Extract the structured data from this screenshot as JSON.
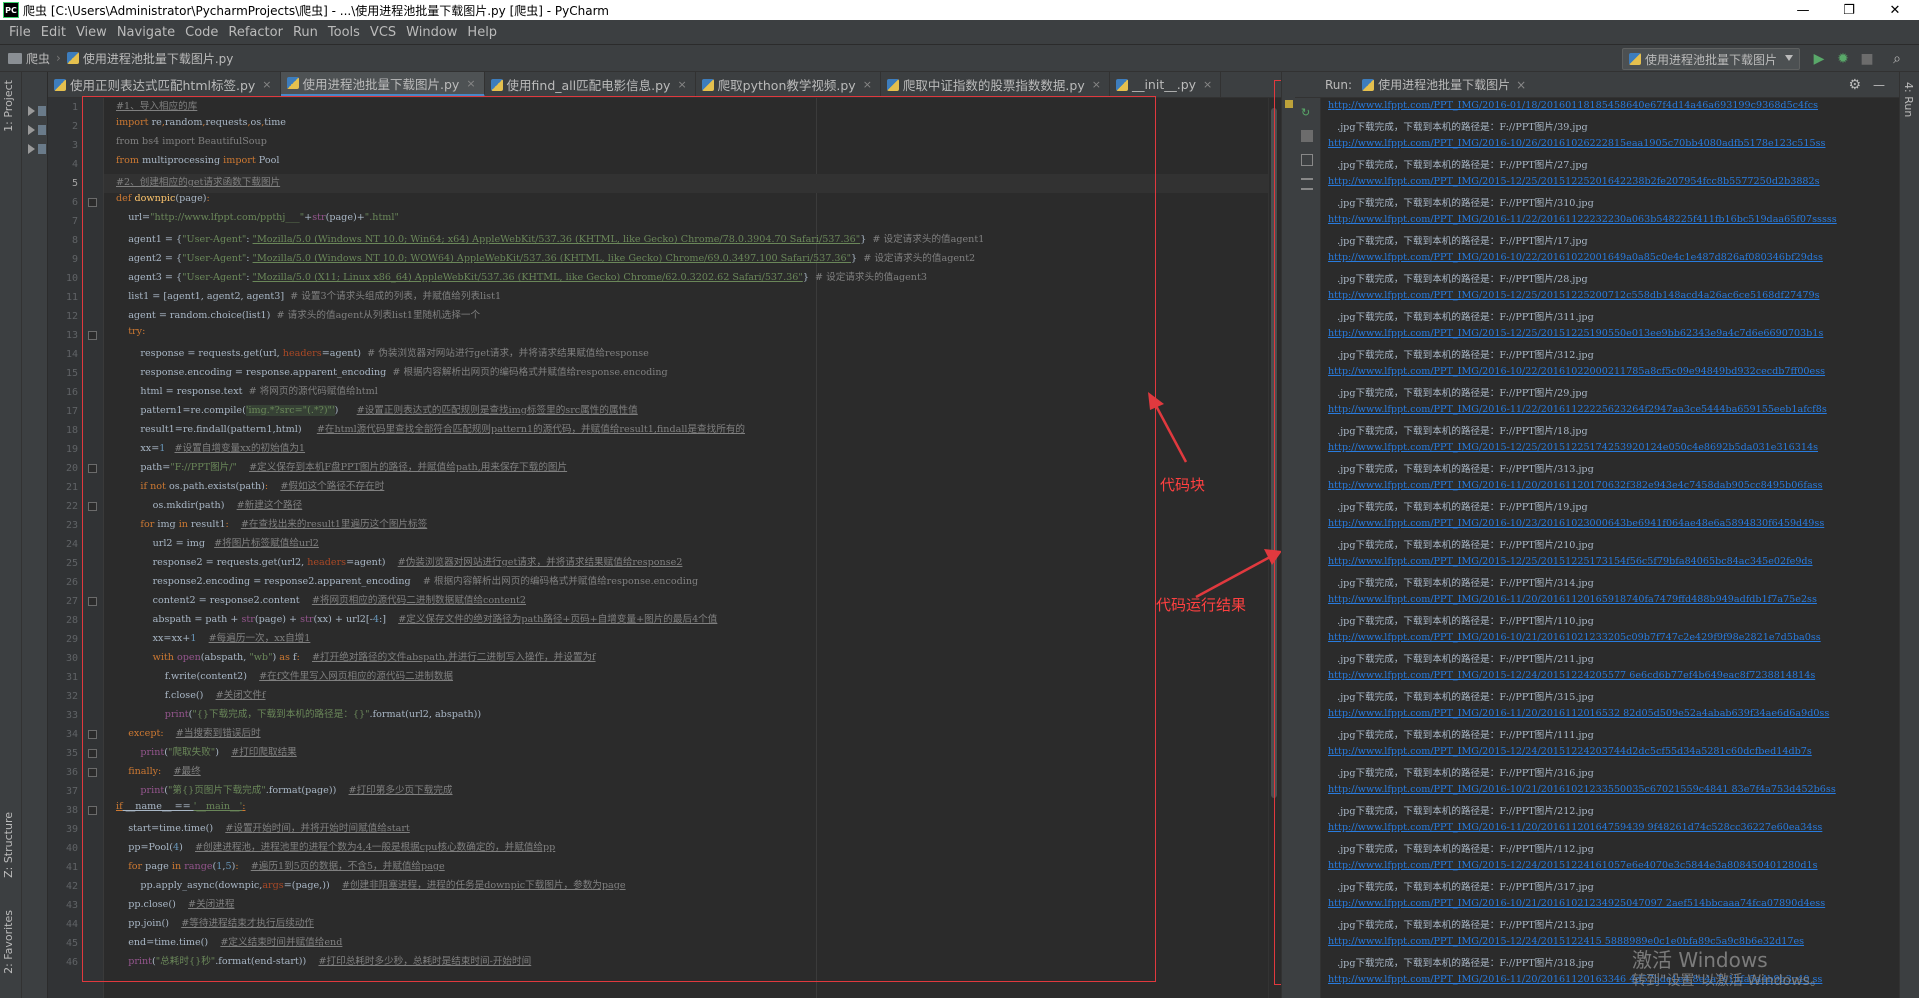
{
  "window": {
    "title": "爬虫 [C:\\Users\\Administrator\\PycharmProjects\\爬虫] - ...\\使用进程池批量下载图片.py [爬虫] - PyCharm",
    "logo_text": "PC",
    "min": "—",
    "max": "❐",
    "close": "✕"
  },
  "menu": [
    "File",
    "Edit",
    "View",
    "Navigate",
    "Code",
    "Refactor",
    "Run",
    "Tools",
    "VCS",
    "Window",
    "Help"
  ],
  "navbar": {
    "project": "爬虫",
    "file": "使用进程池批量下载图片.py"
  },
  "run_config": {
    "label": "使用进程池批量下载图片"
  },
  "left_tools": {
    "project": "1: Project",
    "structure": "Z: Structure",
    "favorites": "2: Favorites"
  },
  "tabs": [
    {
      "label": "使用正则表达式匹配html标签.py",
      "active": false
    },
    {
      "label": "使用进程池批量下载图片.py",
      "active": true
    },
    {
      "label": "使用find_all匹配电影信息.py",
      "active": false
    },
    {
      "label": "爬取python教学视频.py",
      "active": false
    },
    {
      "label": "爬取中证指数的股票指数数据.py",
      "active": false
    },
    {
      "label": "__init__.py",
      "active": false
    }
  ],
  "tab_close": "×",
  "code": {
    "line_numbers": [
      "1",
      "2",
      "3",
      "4",
      "5",
      "6",
      "7",
      "8",
      "9",
      "10",
      "11",
      "12",
      "13",
      "14",
      "15",
      "16",
      "17",
      "18",
      "19",
      "20",
      "21",
      "22",
      "23",
      "24",
      "25",
      "26",
      "27",
      "28",
      "29",
      "30",
      "31",
      "32",
      "33",
      "34",
      "35",
      "36",
      "37",
      "38",
      "39",
      "40",
      "41",
      "42",
      "43",
      "44",
      "45",
      "46"
    ],
    "current_line": 5
  },
  "annotations": {
    "code_block": "代码块",
    "run_result": "代码运行结果"
  },
  "run_panel": {
    "label": "Run:",
    "config": "使用进程池批量下载图片",
    "gear": "⚙",
    "hide": "—",
    "side_label": "4: Run"
  },
  "output": [
    {
      "link": "http://www.lfppt.com/PPT_IMG/2016-01/18/20160118185458640e67f4d14a46a693199c9368d5c4fcs"
    },
    {
      "text": "   .jpg下载完成，下载到本机的路径是：F://PPT图片/39.jpg"
    },
    {
      "link": "http://www.lfppt.com/PPT_IMG/2016-10/26/20161026222815eaa1905c70bb4080adfb5178e123c515ss"
    },
    {
      "text": "   .jpg下载完成，下载到本机的路径是：F://PPT图片/27.jpg"
    },
    {
      "link": "http://www.lfppt.com/PPT_IMG/2015-12/25/20151225201642238b2fe207954fcc8b5577250d2b3882s"
    },
    {
      "text": "   .jpg下载完成，下载到本机的路径是：F://PPT图片/310.jpg"
    },
    {
      "link": "http://www.lfppt.com/PPT_IMG/2016-11/22/20161122232230a063b548225f411fb16bc519daa65f07sssss"
    },
    {
      "text": "   .jpg下载完成，下载到本机的路径是：F://PPT图片/17.jpg"
    },
    {
      "link": "http://www.lfppt.com/PPT_IMG/2016-10/22/20161022001649a0a85c0e4c1e487d826af080346bf29dss"
    },
    {
      "text": "   .jpg下载完成，下载到本机的路径是：F://PPT图片/28.jpg"
    },
    {
      "link": "http://www.lfppt.com/PPT_IMG/2015-12/25/20151225200712c558db148acd4a26ac6ce5168df27479s"
    },
    {
      "text": "   .jpg下载完成，下载到本机的路径是：F://PPT图片/311.jpg"
    },
    {
      "link": "http://www.lfppt.com/PPT_IMG/2015-12/25/20151225190550e013ee9bb62343e9a4c7d6e6690703b1s"
    },
    {
      "text": "   .jpg下载完成，下载到本机的路径是：F://PPT图片/312.jpg"
    },
    {
      "link": "http://www.lfppt.com/PPT_IMG/2016-10/22/20161022000211785a8cf5c09e94849bd932cecdb7ff00ess"
    },
    {
      "text": "   .jpg下载完成，下载到本机的路径是：F://PPT图片/29.jpg"
    },
    {
      "link": "http://www.lfppt.com/PPT_IMG/2016-11/22/20161122225623264f2947aa3ce5444ba659155eeb1afcf8s"
    },
    {
      "text": "   .jpg下载完成，下载到本机的路径是：F://PPT图片/18.jpg"
    },
    {
      "link": "http://www.lfppt.com/PPT_IMG/2015-12/25/20151225174253920124e050c4e8692b5da031e316314s"
    },
    {
      "text": "   .jpg下载完成，下载到本机的路径是：F://PPT图片/313.jpg"
    },
    {
      "link": "http://www.lfppt.com/PPT_IMG/2016-11/20/20161120170632f382e943e4c7458dab905cc8495b06fass"
    },
    {
      "text": "   .jpg下载完成，下载到本机的路径是：F://PPT图片/19.jpg"
    },
    {
      "link": "http://www.lfppt.com/PPT_IMG/2016-10/23/20161023000643be6941f064ae48e6a5894830f6459d49ss"
    },
    {
      "text": "   .jpg下载完成，下载到本机的路径是：F://PPT图片/210.jpg"
    },
    {
      "link": "http://www.lfppt.com/PPT_IMG/2015-12/25/20151225173154f56c5f79bfa84065bc84ac345e02fe9ds"
    },
    {
      "text": "   .jpg下载完成，下载到本机的路径是：F://PPT图片/314.jpg"
    },
    {
      "link": "http://www.lfppt.com/PPT_IMG/2016-11/20/20161120165918740fa7479ffd488b949adfdb1f7a75e2ss"
    },
    {
      "text": "   .jpg下载完成，下载到本机的路径是：F://PPT图片/110.jpg"
    },
    {
      "link": "http://www.lfppt.com/PPT_IMG/2016-10/21/20161021233205c09b7f747c2e429f9f98e2821e7d5ba0ss"
    },
    {
      "text": "   .jpg下载完成，下载到本机的路径是：F://PPT图片/211.jpg"
    },
    {
      "link": "http://www.lfppt.com/PPT_IMG/2015-12/24/20151224205577 6e6cd6b77ef4b649eac8f7238814814s"
    },
    {
      "text": "   .jpg下载完成，下载到本机的路径是：F://PPT图片/315.jpg"
    },
    {
      "link": "http://www.lfppt.com/PPT_IMG/2016-11/20/2016112016532 82d05d509e52a4abab639f34ae6d6a9d0ss"
    },
    {
      "text": "   .jpg下载完成，下载到本机的路径是：F://PPT图片/111.jpg"
    },
    {
      "link": "http://www.lfppt.com/PPT_IMG/2015-12/24/20151224203744d2dc5cf55d34a5281c60dcfbed14db7s"
    },
    {
      "text": "   .jpg下载完成，下载到本机的路径是：F://PPT图片/316.jpg"
    },
    {
      "link": "http://www.lfppt.com/PPT_IMG/2016-10/21/20161021233550035c67021559c4841 83e7f4a753d452b6ss"
    },
    {
      "text": "   .jpg下载完成，下载到本机的路径是：F://PPT图片/212.jpg"
    },
    {
      "link": "http://www.lfppt.com/PPT_IMG/2016-11/20/20161120164759439 9f48261d74c528cc36227e60ea34ss"
    },
    {
      "text": "   .jpg下载完成，下载到本机的路径是：F://PPT图片/112.jpg"
    },
    {
      "link": "http://www.lfppt.com/PPT_IMG/2015-12/24/20151224161057e6e4070e3c5844e3a808450401280d1s"
    },
    {
      "text": "   .jpg下载完成，下载到本机的路径是：F://PPT图片/317.jpg"
    },
    {
      "link": "http://www.lfppt.com/PPT_IMG/2016-10/21/20161021234925047097 2aef514bbcaaa74fca07890d4ess"
    },
    {
      "text": "   .jpg下载完成，下载到本机的路径是：F://PPT图片/213.jpg"
    },
    {
      "link": "http://www.lfppt.com/PPT_IMG/2015-12/24/2015122415 5888989e0c1e0bfa89c5a9c8b6e32d17es"
    },
    {
      "text": "   .jpg下载完成，下载到本机的路径是：F://PPT图片/318.jpg"
    },
    {
      "link": "http://www.lfppt.com/PPT_IMG/2016-11/20/20161120163346 4d57bde1e4 8e4a7e1bfa5a4b9b3c40 ss"
    }
  ],
  "watermark": {
    "line1": "激活 Windows",
    "line2": "转到\"设置\"以激活 Windows。"
  }
}
